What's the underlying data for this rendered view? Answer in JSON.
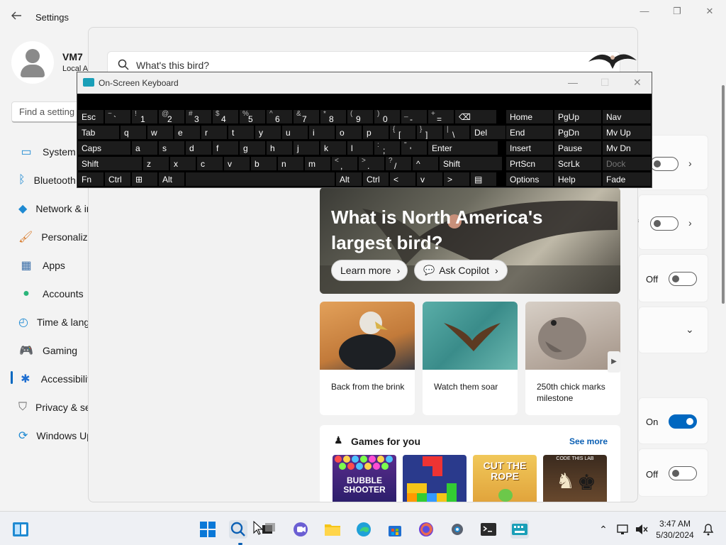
{
  "settings": {
    "title": "Settings",
    "user": {
      "name": "VM7",
      "sub": "Local A"
    },
    "find_placeholder": "Find a setting",
    "nav": [
      {
        "label": "System",
        "icon": "system-icon"
      },
      {
        "label": "Bluetooth & devices",
        "icon": "bluetooth-icon"
      },
      {
        "label": "Network & internet",
        "icon": "network-icon"
      },
      {
        "label": "Personalization",
        "icon": "brush-icon"
      },
      {
        "label": "Apps",
        "icon": "apps-icon"
      },
      {
        "label": "Accounts",
        "icon": "accounts-icon"
      },
      {
        "label": "Time & language",
        "icon": "clock-icon"
      },
      {
        "label": "Gaming",
        "icon": "gamepad-icon"
      },
      {
        "label": "Accessibility",
        "icon": "accessibility-icon"
      },
      {
        "label": "Privacy & security",
        "icon": "shield-icon"
      },
      {
        "label": "Windows Update",
        "icon": "update-icon"
      }
    ],
    "toggles": [
      {
        "label": "",
        "state": "off"
      },
      {
        "label": "f",
        "state": "off"
      },
      {
        "label": "Off",
        "state": "off"
      },
      {
        "label": "On",
        "state": "on"
      },
      {
        "label": "Off",
        "state": "off"
      }
    ]
  },
  "search": {
    "query": "What's this bird?",
    "hero": {
      "title": "What is North America's largest bird?",
      "learn_more": "Learn more",
      "ask_copilot": "Ask Copilot"
    },
    "cards": [
      {
        "caption": "Back from the brink"
      },
      {
        "caption": "Watch them soar"
      },
      {
        "caption": "250th chick marks milestone"
      }
    ],
    "games": {
      "heading": "Games for you",
      "see_more": "See more",
      "tiles": [
        "BUBBLE SHOOTER",
        "",
        "CUT THE ROPE",
        "CODE THIS LAB"
      ]
    }
  },
  "osk": {
    "title": "On-Screen Keyboard",
    "rows": [
      [
        {
          "m": "Esc"
        },
        {
          "s": "~",
          "m": "`"
        },
        {
          "s": "!",
          "m": "1"
        },
        {
          "s": "@",
          "m": "2"
        },
        {
          "s": "#",
          "m": "3"
        },
        {
          "s": "$",
          "m": "4"
        },
        {
          "s": "%",
          "m": "5"
        },
        {
          "s": "^",
          "m": "6"
        },
        {
          "s": "&",
          "m": "7"
        },
        {
          "s": "*",
          "m": "8"
        },
        {
          "s": "(",
          "m": "9"
        },
        {
          "s": ")",
          "m": "0"
        },
        {
          "s": "_",
          "m": "-"
        },
        {
          "s": "+",
          "m": "="
        },
        {
          "m": "⌫"
        }
      ],
      [
        {
          "m": "Tab"
        },
        {
          "m": "q"
        },
        {
          "m": "w"
        },
        {
          "m": "e"
        },
        {
          "m": "r"
        },
        {
          "m": "t"
        },
        {
          "m": "y"
        },
        {
          "m": "u"
        },
        {
          "m": "i"
        },
        {
          "m": "o"
        },
        {
          "m": "p"
        },
        {
          "s": "{",
          "m": "["
        },
        {
          "s": "}",
          "m": "]"
        },
        {
          "s": "|",
          "m": "\\"
        },
        {
          "m": "Del"
        }
      ],
      [
        {
          "m": "Caps"
        },
        {
          "m": "a"
        },
        {
          "m": "s"
        },
        {
          "m": "d"
        },
        {
          "m": "f"
        },
        {
          "m": "g"
        },
        {
          "m": "h"
        },
        {
          "m": "j"
        },
        {
          "m": "k"
        },
        {
          "m": "l"
        },
        {
          "s": ":",
          "m": ";"
        },
        {
          "s": "\"",
          "m": "'"
        },
        {
          "m": "Enter"
        }
      ],
      [
        {
          "m": "Shift"
        },
        {
          "m": "z"
        },
        {
          "m": "x"
        },
        {
          "m": "c"
        },
        {
          "m": "v"
        },
        {
          "m": "b"
        },
        {
          "m": "n"
        },
        {
          "m": "m"
        },
        {
          "s": "<",
          "m": ","
        },
        {
          "s": ">",
          "m": "."
        },
        {
          "s": "?",
          "m": "/"
        },
        {
          "m": "^"
        },
        {
          "m": "Shift"
        }
      ],
      [
        {
          "m": "Fn"
        },
        {
          "m": "Ctrl"
        },
        {
          "m": "⊞"
        },
        {
          "m": "Alt"
        },
        {
          "m": ""
        },
        {
          "m": "Alt"
        },
        {
          "m": "Ctrl"
        },
        {
          "m": "<"
        },
        {
          "m": "v"
        },
        {
          "m": ">"
        },
        {
          "m": "▤"
        }
      ]
    ],
    "nav_keys": [
      [
        "Home",
        "PgUp",
        "Nav"
      ],
      [
        "End",
        "PgDn",
        "Mv Up"
      ],
      [
        "Insert",
        "Pause",
        "Mv Dn"
      ],
      [
        "PrtScn",
        "ScrLk",
        "Dock"
      ],
      [
        "Options",
        "Help",
        "Fade"
      ]
    ]
  },
  "taskbar": {
    "time": "3:47 AM",
    "date": "5/30/2024"
  }
}
